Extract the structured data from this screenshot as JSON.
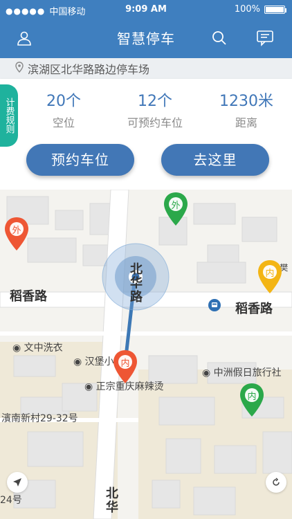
{
  "status_bar": {
    "carrier": "中国移动",
    "time": "9:09 AM",
    "battery": "100%",
    "signal_icon": "signal-dots-icon",
    "battery_icon": "battery-icon"
  },
  "nav": {
    "title": "智慧停车",
    "user_icon": "user-icon",
    "search_icon": "search-icon",
    "message_icon": "message-icon"
  },
  "address": {
    "text": "滨湖区北华路路边停车场",
    "icon": "location-pin-icon"
  },
  "info_panel": {
    "rule_tab": "计费规则",
    "stats": [
      {
        "value": "20个",
        "label": "空位"
      },
      {
        "value": "12个",
        "label": "可预约车位"
      },
      {
        "value": "1230米",
        "label": "距离"
      }
    ],
    "reserve_button": "预约车位",
    "goto_button": "去这里"
  },
  "map": {
    "road_labels": {
      "daoxiang_left": "稻香路",
      "daoxiang_right": "稻香路",
      "beihua_top": "北华路",
      "beihua_bottom": "北华"
    },
    "pois": {
      "laundry": "文中洗衣",
      "burger": "汉堡小",
      "spicy_pot": "正宗重庆麻辣烫",
      "hotel": "中洲假日旅行社",
      "xinjiang": "濱南新村29-32号",
      "left_small": "24号",
      "right_partial": "樊街"
    },
    "markers": [
      {
        "label": "外",
        "color": "#2ba84a"
      },
      {
        "label": "外",
        "color": "#ee5634"
      },
      {
        "label": "内",
        "color": "#f3b514"
      },
      {
        "label": "内",
        "color": "#ee5634"
      },
      {
        "label": "内",
        "color": "#2ba84a"
      }
    ],
    "locate_icon": "locate-arrow-icon",
    "refresh_icon": "refresh-icon",
    "bus_icon": "bus-stop-icon"
  },
  "colors": {
    "brand": "#3f7fbf",
    "button": "#4277b6",
    "rule_tab": "#1fb29d",
    "stat_value": "#4077b8"
  }
}
